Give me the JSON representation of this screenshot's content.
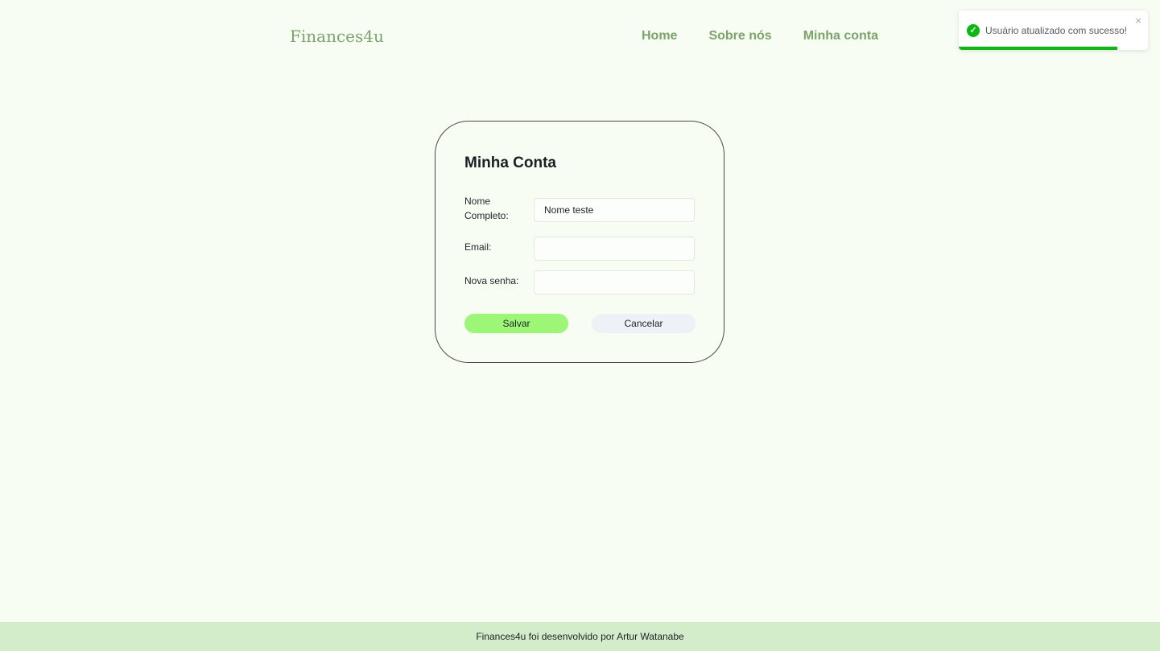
{
  "header": {
    "logo": "Finances4u",
    "nav": [
      {
        "label": "Home"
      },
      {
        "label": "Sobre nós"
      },
      {
        "label": "Minha conta"
      }
    ]
  },
  "card": {
    "title": "Minha Conta",
    "fields": {
      "name": {
        "label_line1": "Nome",
        "label_line2": "Completo:",
        "value": "Nome teste"
      },
      "email": {
        "label": "Email:",
        "value": ""
      },
      "password": {
        "label": "Nova senha:",
        "value": ""
      }
    },
    "save_label": "Salvar",
    "cancel_label": "Cancelar"
  },
  "footer": {
    "text": "Finances4u foi desenvolvido por Artur Watanabe"
  },
  "toast": {
    "message": "Usuário atualizado com sucesso!",
    "close_glyph": "×",
    "status_icon": "check-circle-icon",
    "status_color": "#07bc0c",
    "progress_fraction": 0.84
  },
  "colors": {
    "background": "#f7fdf2",
    "brand": "#7aa56a",
    "save_button": "#9cf776",
    "footer_bg": "#d3ecca"
  }
}
